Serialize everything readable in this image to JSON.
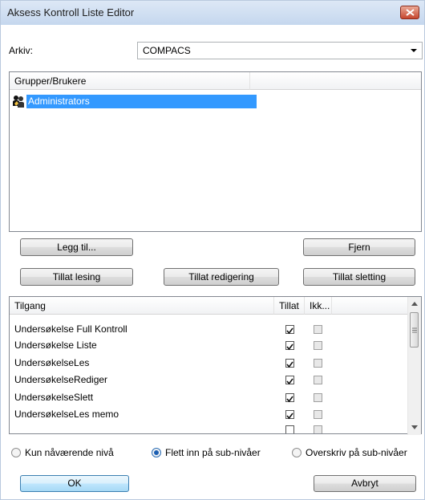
{
  "window": {
    "title": "Aksess Kontroll Liste Editor"
  },
  "archive": {
    "label": "Arkiv:",
    "value": "COMPACS"
  },
  "groups": {
    "header": "Grupper/Brukere",
    "items": [
      {
        "name": "Administrators",
        "icon": "user-group-icon",
        "selected": true
      }
    ]
  },
  "buttons": {
    "add": "Legg til...",
    "remove": "Fjern",
    "allow_read": "Tillat lesing",
    "allow_edit": "Tillat redigering",
    "allow_delete": "Tillat sletting",
    "ok": "OK",
    "cancel": "Avbryt"
  },
  "access": {
    "headers": [
      "Tilgang",
      "Tillat",
      "Ikk..."
    ],
    "rows": [
      {
        "name": "Undersøkelse Full Kontroll",
        "allow": true,
        "deny": false
      },
      {
        "name": "Undersøkelse Liste",
        "allow": true,
        "deny": false
      },
      {
        "name": "UndersøkelseLes",
        "allow": true,
        "deny": false
      },
      {
        "name": "UndersøkelseRediger",
        "allow": true,
        "deny": false
      },
      {
        "name": "UndersøkelseSlett",
        "allow": true,
        "deny": false
      },
      {
        "name": "UndersøkelseLes memo",
        "allow": true,
        "deny": false
      }
    ]
  },
  "scope": {
    "options": [
      "Kun nåværende nivå",
      "Flett inn på sub-nivåer",
      "Overskriv på sub-nivåer"
    ],
    "selected": 1
  }
}
